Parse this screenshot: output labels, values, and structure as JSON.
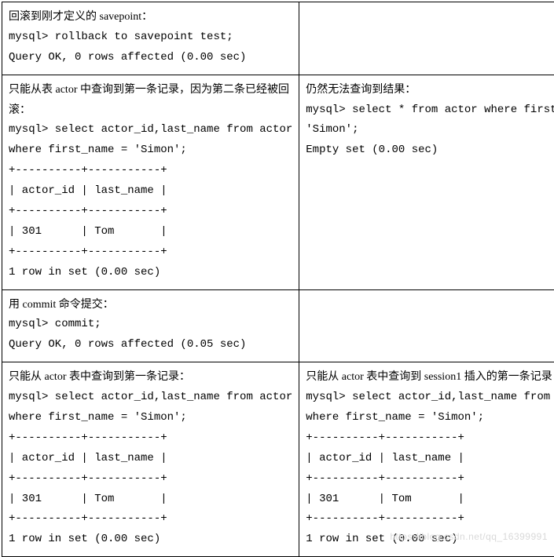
{
  "rows": [
    {
      "left": {
        "desc": "回滚到刚才定义的 savepoint：",
        "lines": [
          "mysql> rollback to savepoint test;",
          "Query OK, 0 rows affected (0.00 sec)"
        ]
      },
      "right": null
    },
    {
      "left": {
        "desc": "只能从表 actor 中查询到第一条记录，因为第二条已经被回滚：",
        "lines": [
          "mysql> select actor_id,last_name from actor",
          "where first_name = 'Simon';",
          "+----------+-----------+",
          "| actor_id | last_name |",
          "+----------+-----------+",
          "| 301      | Tom       |",
          "+----------+-----------+",
          "1 row in set (0.00 sec)"
        ]
      },
      "right": {
        "desc": "仍然无法查询到结果：",
        "lines": [
          "mysql> select * from actor where first_name =",
          "'Simon';",
          "Empty set (0.00 sec)"
        ]
      }
    },
    {
      "left": {
        "desc": "用 commit 命令提交：",
        "lines": [
          "mysql> commit;",
          "Query OK, 0 rows affected (0.05 sec)"
        ]
      },
      "right": null
    },
    {
      "left": {
        "desc": "只能从 actor 表中查询到第一条记录：",
        "lines": [
          "mysql> select actor_id,last_name from actor",
          "where first_name = 'Simon';",
          "+----------+-----------+",
          "| actor_id | last_name |",
          "+----------+-----------+",
          "| 301      | Tom       |",
          "+----------+-----------+",
          "1 row in set (0.00 sec)"
        ]
      },
      "right": {
        "desc": "只能从 actor 表中查询到 session1 插入的第一条记录：",
        "lines": [
          "mysql> select actor_id,last_name from actor",
          "where first_name = 'Simon';",
          "+----------+-----------+",
          "| actor_id | last_name |",
          "+----------+-----------+",
          "| 301      | Tom       |",
          "+----------+-----------+",
          "1 row in set (0.00 sec)"
        ]
      }
    }
  ],
  "watermark": "https://blog.csdn.net/qq_16399991"
}
